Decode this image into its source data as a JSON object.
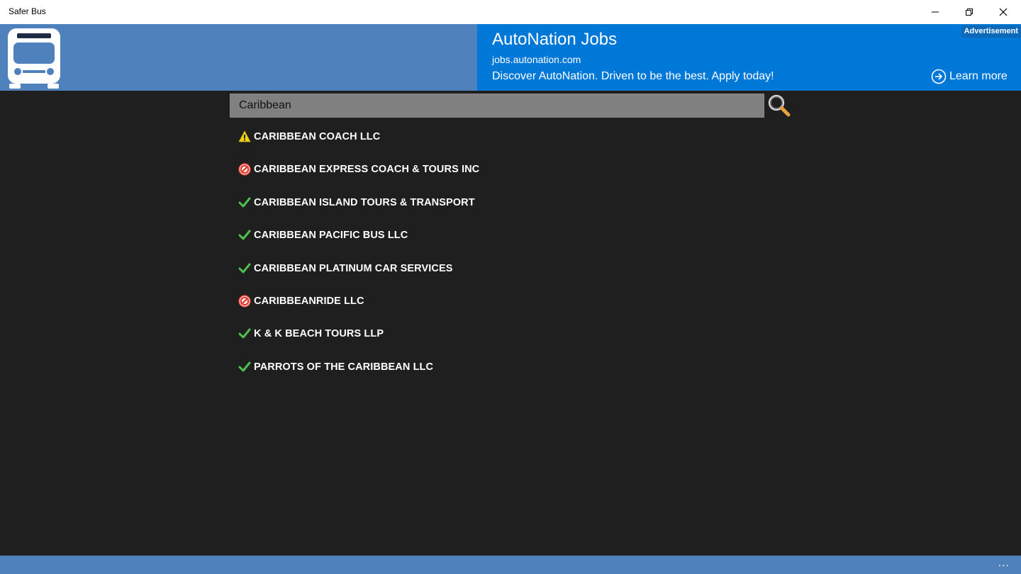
{
  "window": {
    "title": "Safer Bus"
  },
  "ad": {
    "badge": "Advertisement",
    "title": "AutoNation Jobs",
    "url": "jobs.autonation.com",
    "description": "Discover AutoNation. Driven to be the best. Apply today!",
    "cta": "Learn more"
  },
  "search": {
    "value": "Caribbean",
    "icon": "magnifier-icon"
  },
  "results": [
    {
      "label": "CARIBBEAN COACH LLC",
      "status": "warning"
    },
    {
      "label": "CARIBBEAN EXPRESS COACH & TOURS INC",
      "status": "blocked"
    },
    {
      "label": "CARIBBEAN ISLAND TOURS & TRANSPORT",
      "status": "ok"
    },
    {
      "label": "CARIBBEAN PACIFIC BUS LLC",
      "status": "ok"
    },
    {
      "label": "CARIBBEAN PLATINUM CAR SERVICES",
      "status": "ok"
    },
    {
      "label": "CARIBBEANRIDE LLC",
      "status": "blocked"
    },
    {
      "label": "K & K BEACH TOURS LLP",
      "status": "ok"
    },
    {
      "label": "PARROTS OF THE CARIBBEAN LLC",
      "status": "ok"
    }
  ],
  "bottom_bar": {
    "more": "..."
  },
  "colors": {
    "header": "#4f81bd",
    "ad": "#0078d7",
    "background": "#1f1f1f",
    "ok": "#4ec04e",
    "warning": "#f2d21b",
    "blocked": "#e03c31"
  }
}
